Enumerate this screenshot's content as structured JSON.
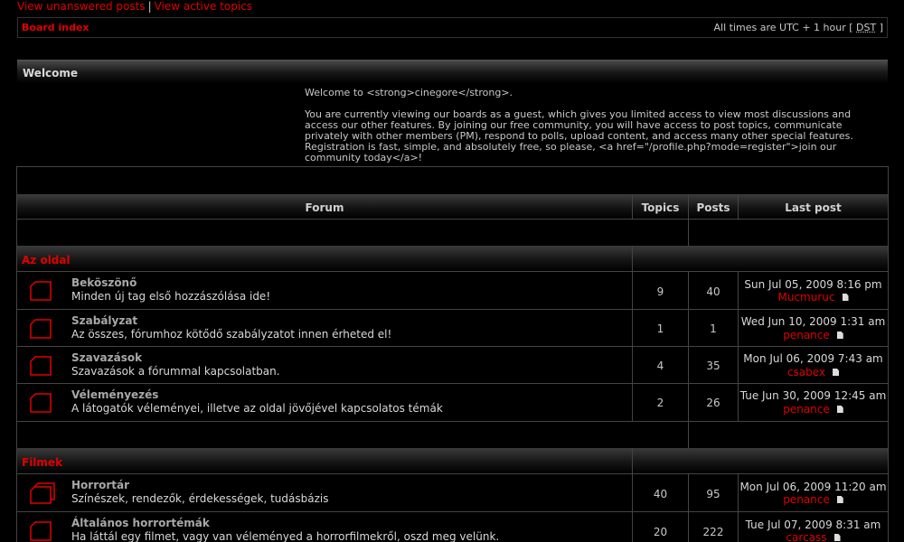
{
  "top_links": {
    "unanswered": "View unanswered posts",
    "separator": "|",
    "active": "View active topics"
  },
  "navbar": {
    "board_index": "Board index",
    "times_prefix": "All times are UTC + 1 hour [",
    "dst": "DST",
    "times_suffix": "]"
  },
  "welcome": {
    "title": "Welcome",
    "line1": "Welcome to <strong>cinegore</strong>.",
    "line2": "You are currently viewing our boards as a guest, which gives you limited access to view most discussions and access our other features. By joining our free community, you will have access to post topics, communicate privately with other members (PM), respond to polls, upload content, and access many other special features. Registration is fast, simple, and absolutely free, so please, <a href=\"/profile.php?mode=register\">join our community today</a>!"
  },
  "table": {
    "headers": {
      "forum": "Forum",
      "topics": "Topics",
      "posts": "Posts",
      "last_post": "Last post"
    }
  },
  "categories": [
    {
      "name": "Az oldal",
      "forums": [
        {
          "title": "Beköszönő",
          "desc": "Minden új tag első hozzászólása ide!",
          "topics": "9",
          "posts": "40",
          "last_date": "Sun Jul 05, 2009 8:16 pm",
          "last_user": "Mucmuruc"
        },
        {
          "title": "Szabályzat",
          "desc": "Az összes, fórumhoz kötődő szabályzatot innen érheted el!",
          "topics": "1",
          "posts": "1",
          "last_date": "Wed Jun 10, 2009 1:31 am",
          "last_user": "penance"
        },
        {
          "title": "Szavazások",
          "desc": "Szavazások a fórummal kapcsolatban.",
          "topics": "4",
          "posts": "35",
          "last_date": "Mon Jul 06, 2009 7:43 am",
          "last_user": "csabex"
        },
        {
          "title": "Véleményezés",
          "desc": "A látogatók véleményei, illetve az oldal jövőjével kapcsolatos témák",
          "topics": "2",
          "posts": "26",
          "last_date": "Tue Jun 30, 2009 12:45 am",
          "last_user": "penance"
        }
      ]
    },
    {
      "name": "Filmek",
      "forums": [
        {
          "title": "Horrortár",
          "desc": "Színészek, rendezők, érdekességek, tudásbázis",
          "topics": "40",
          "posts": "95",
          "last_date": "Mon Jul 06, 2009 11:20 am",
          "last_user": "penance"
        },
        {
          "title": "Általános horrortémák",
          "desc": "Ha láttál egy filmet, vagy van véleményed a horrorfilmekről, oszd meg velünk.",
          "topics": "20",
          "posts": "222",
          "last_date": "Tue Jul 07, 2009 8:31 am",
          "last_user": "carcass"
        }
      ]
    }
  ],
  "colors": {
    "accent": "#e00000",
    "background": "#000000",
    "text": "#c8c8c8"
  }
}
